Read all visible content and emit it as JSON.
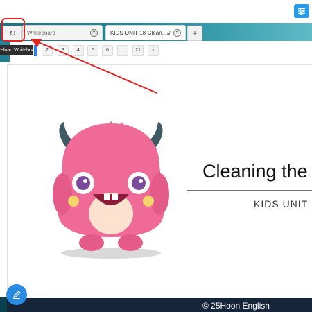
{
  "tabs": [
    {
      "label": "Whiteboard"
    },
    {
      "label": "KIDS-UNIT-18-Clean..."
    }
  ],
  "tooltip": "Reload Whiteboard",
  "pages": [
    "2",
    "3",
    "4",
    "5",
    "6",
    "...",
    "21"
  ],
  "slide": {
    "title": "Cleaning the",
    "subtitle": "KIDS UNIT",
    "footer": "© 25Hoon English"
  },
  "icons": {
    "top_right": "settings-sliders-icon",
    "refresh": "refresh-icon",
    "tab_close": "close-circle-icon",
    "tab_lock": "unlock-icon",
    "add_tab": "plus-icon",
    "next_page": "chevron-right-icon",
    "pen": "pen-icon"
  },
  "colors": {
    "accent": "#2b8be2",
    "footer_bg": "#17253b",
    "annotation": "#e02222",
    "monster_pink": "#f06a98"
  }
}
